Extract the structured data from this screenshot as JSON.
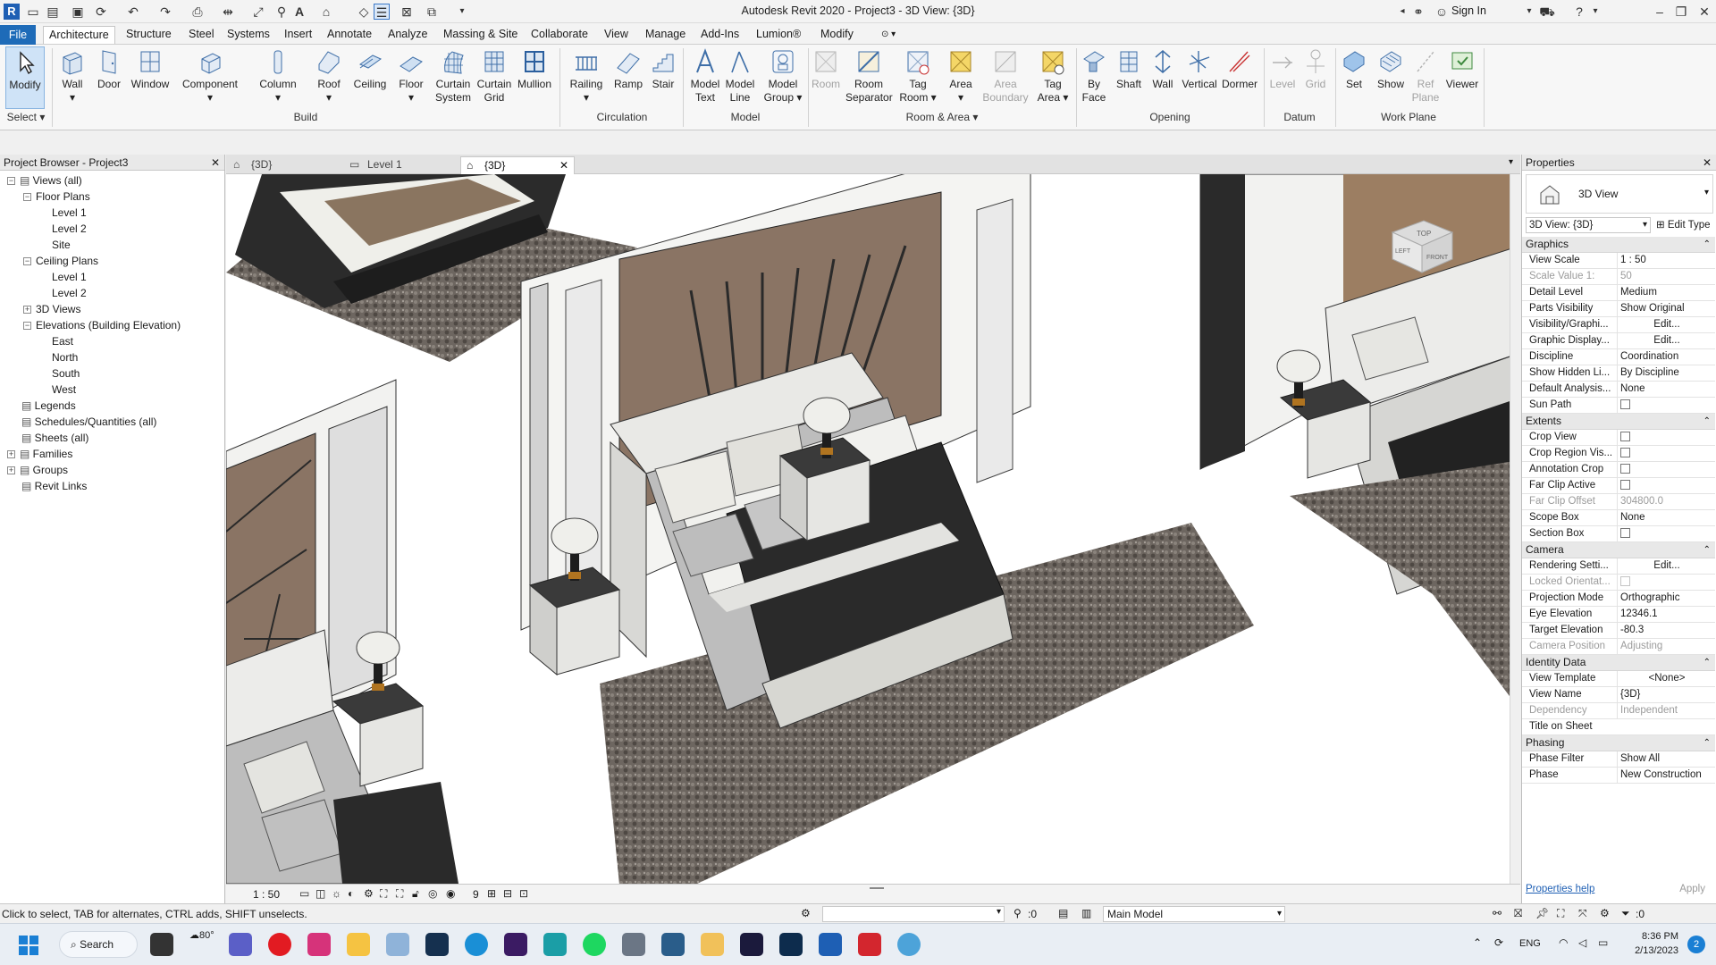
{
  "titlebar": {
    "title": "Autodesk Revit 2020 - Project3 - 3D View: {3D}",
    "sign_in": "Sign In"
  },
  "menu": {
    "file": "File",
    "tabs": [
      "Architecture",
      "Structure",
      "Steel",
      "Systems",
      "Insert",
      "Annotate",
      "Analyze",
      "Massing & Site",
      "Collaborate",
      "View",
      "Manage",
      "Add-Ins",
      "Lumion®",
      "Modify"
    ],
    "active_tab": "Architecture"
  },
  "ribbon": {
    "modify": "Modify",
    "select": "Select",
    "build": {
      "label": "Build",
      "tools": [
        "Wall",
        "Door",
        "Window",
        "Component",
        "Column",
        "Roof",
        "Ceiling",
        "Floor",
        "Curtain System",
        "Curtain Grid",
        "Mullion"
      ]
    },
    "circulation": {
      "label": "Circulation",
      "tools": [
        "Railing",
        "Ramp",
        "Stair"
      ]
    },
    "model": {
      "label": "Model",
      "tools": [
        "Model Text",
        "Model Line",
        "Model Group"
      ]
    },
    "room_area": {
      "label": "Room & Area",
      "tools": [
        "Room",
        "Room Separator",
        "Tag Room",
        "Area",
        "Area Boundary",
        "Tag Area"
      ]
    },
    "opening": {
      "label": "Opening",
      "tools": [
        "By Face",
        "Shaft",
        "Wall",
        "Vertical",
        "Dormer"
      ]
    },
    "datum": {
      "label": "Datum",
      "tools": [
        "Level",
        "Grid"
      ]
    },
    "work_plane": {
      "label": "Work Plane",
      "tools": [
        "Set",
        "Show",
        "Ref Plane",
        "Viewer"
      ]
    }
  },
  "project_browser": {
    "title": "Project Browser - Project3",
    "tree": [
      {
        "label": "Views (all)",
        "level": 0,
        "toggle": "−"
      },
      {
        "label": "Floor Plans",
        "level": 1,
        "toggle": "−"
      },
      {
        "label": "Level 1",
        "level": 2
      },
      {
        "label": "Level 2",
        "level": 2
      },
      {
        "label": "Site",
        "level": 2
      },
      {
        "label": "Ceiling Plans",
        "level": 1,
        "toggle": "−"
      },
      {
        "label": "Level 1",
        "level": 2
      },
      {
        "label": "Level 2",
        "level": 2
      },
      {
        "label": "3D Views",
        "level": 1,
        "toggle": "+"
      },
      {
        "label": "Elevations (Building Elevation)",
        "level": 1,
        "toggle": "−"
      },
      {
        "label": "East",
        "level": 2
      },
      {
        "label": "North",
        "level": 2
      },
      {
        "label": "South",
        "level": 2
      },
      {
        "label": "West",
        "level": 2
      },
      {
        "label": "Legends",
        "level": 0
      },
      {
        "label": "Schedules/Quantities (all)",
        "level": 0
      },
      {
        "label": "Sheets (all)",
        "level": 0
      },
      {
        "label": "Families",
        "level": 0,
        "toggle": "+"
      },
      {
        "label": "Groups",
        "level": 0,
        "toggle": "+"
      },
      {
        "label": "Revit Links",
        "level": 0
      }
    ]
  },
  "view_tabs": [
    {
      "label": "{3D}",
      "active": false
    },
    {
      "label": "Level 1",
      "active": false
    },
    {
      "label": "{3D}",
      "active": true
    }
  ],
  "viewcube": {
    "top": "TOP",
    "front": "FRONT",
    "left": "LEFT"
  },
  "view_control": {
    "scale": "1 : 50",
    "count": "9"
  },
  "properties": {
    "title": "Properties",
    "type_name": "3D View",
    "instance": "3D View: {3D}",
    "edit_type": "Edit Type",
    "sections": [
      {
        "name": "Graphics",
        "rows": [
          {
            "k": "View Scale",
            "v": "1 : 50"
          },
          {
            "k": "Scale Value    1:",
            "v": "50",
            "grey": true
          },
          {
            "k": "Detail Level",
            "v": "Medium"
          },
          {
            "k": "Parts Visibility",
            "v": "Show Original"
          },
          {
            "k": "Visibility/Graphi...",
            "v": "Edit...",
            "btn": true
          },
          {
            "k": "Graphic Display...",
            "v": "Edit...",
            "btn": true
          },
          {
            "k": "Discipline",
            "v": "Coordination"
          },
          {
            "k": "Show Hidden Li...",
            "v": "By Discipline"
          },
          {
            "k": "Default Analysis...",
            "v": "None"
          },
          {
            "k": "Sun Path",
            "v": "",
            "check": true
          }
        ]
      },
      {
        "name": "Extents",
        "rows": [
          {
            "k": "Crop View",
            "v": "",
            "check": true
          },
          {
            "k": "Crop Region Vis...",
            "v": "",
            "check": true
          },
          {
            "k": "Annotation Crop",
            "v": "",
            "check": true
          },
          {
            "k": "Far Clip Active",
            "v": "",
            "check": true
          },
          {
            "k": "Far Clip Offset",
            "v": "304800.0",
            "grey": true
          },
          {
            "k": "Scope Box",
            "v": "None"
          },
          {
            "k": "Section Box",
            "v": "",
            "check": true
          }
        ]
      },
      {
        "name": "Camera",
        "rows": [
          {
            "k": "Rendering Setti...",
            "v": "Edit...",
            "btn": true
          },
          {
            "k": "Locked Orientat...",
            "v": "",
            "check": true,
            "grey": true
          },
          {
            "k": "Projection Mode",
            "v": "Orthographic"
          },
          {
            "k": "Eye Elevation",
            "v": "12346.1"
          },
          {
            "k": "Target Elevation",
            "v": "-80.3"
          },
          {
            "k": "Camera Position",
            "v": "Adjusting",
            "grey": true
          }
        ]
      },
      {
        "name": "Identity Data",
        "rows": [
          {
            "k": "View Template",
            "v": "<None>",
            "btn": true
          },
          {
            "k": "View Name",
            "v": "{3D}"
          },
          {
            "k": "Dependency",
            "v": "Independent",
            "grey": true
          },
          {
            "k": "Title on Sheet",
            "v": ""
          }
        ]
      },
      {
        "name": "Phasing",
        "rows": [
          {
            "k": "Phase Filter",
            "v": "Show All"
          },
          {
            "k": "Phase",
            "v": "New Construction"
          }
        ]
      }
    ],
    "help": "Properties help",
    "apply": "Apply"
  },
  "status": {
    "hint": "Click to select, TAB for alternates, CTRL adds, SHIFT unselects.",
    "selection_count": ":0",
    "model": "Main Model",
    "filter_count": ":0"
  },
  "taskbar": {
    "search": "Search",
    "weather": "80°",
    "lang": "ENG",
    "time": "8:36 PM",
    "date": "2/13/2023",
    "notifications": "2"
  }
}
